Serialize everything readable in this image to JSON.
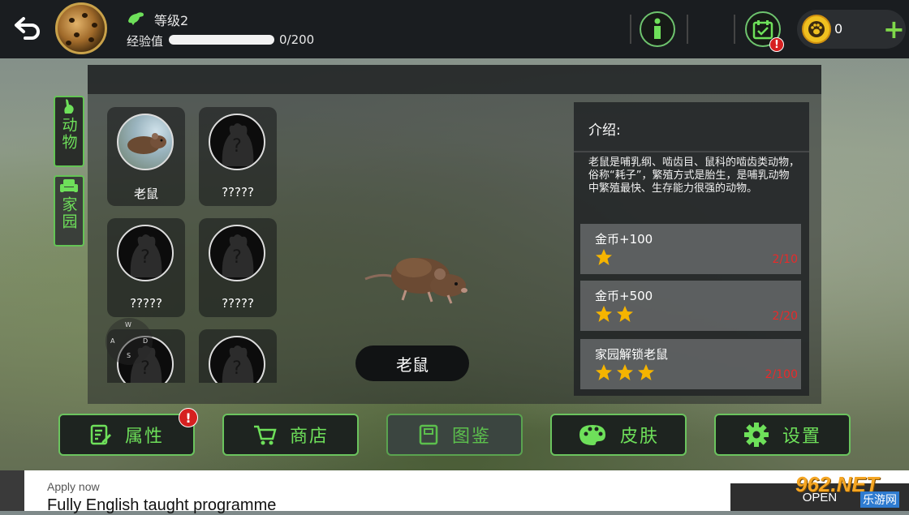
{
  "topbar": {
    "level_label": "等级2",
    "xp_label": "经验值",
    "xp_value": "0/200",
    "xp_progress": 0.0,
    "currency_amount": "0"
  },
  "side_tabs": [
    {
      "label": "动物",
      "icon": "rabbit-icon"
    },
    {
      "label": "家园",
      "icon": "sofa-icon"
    }
  ],
  "animals": [
    {
      "name": "老鼠",
      "unlocked": true
    },
    {
      "name": "?????",
      "unlocked": false
    },
    {
      "name": "?????",
      "unlocked": false
    },
    {
      "name": "?????",
      "unlocked": false
    },
    {
      "name": "",
      "unlocked": false
    },
    {
      "name": "",
      "unlocked": false
    }
  ],
  "joystick": {
    "w": "W",
    "a": "A",
    "s": "S",
    "d": "D"
  },
  "selected_animal": "老鼠",
  "info": {
    "title": "介绍:",
    "description": "老鼠是哺乳纲、啮齿目、鼠科的啮齿类动物，俗称“耗子”，繁殖方式是胎生，是哺乳动物中繁殖最快、生存能力很强的动物。",
    "rewards": [
      {
        "title": "金币+100",
        "stars": 1,
        "progress": "2/10"
      },
      {
        "title": "金币+500",
        "stars": 2,
        "progress": "2/20"
      },
      {
        "title": "家园解锁老鼠",
        "stars": 3,
        "progress": "2/100"
      }
    ]
  },
  "bottom_buttons": [
    {
      "label": "属性",
      "icon": "edit-list-icon",
      "alert": "!"
    },
    {
      "label": "商店",
      "icon": "cart-icon"
    },
    {
      "label": "图鉴",
      "icon": "book-icon",
      "active": true
    },
    {
      "label": "皮肤",
      "icon": "palette-icon"
    },
    {
      "label": "设置",
      "icon": "gear-icon"
    }
  ],
  "alerts": {
    "calendar": "!"
  },
  "ad": {
    "apply": "Apply now",
    "headline": "Fully English taught programme",
    "open": "OPEN"
  },
  "watermark": {
    "logo": "962.NET",
    "sub": "乐游网"
  },
  "colors": {
    "accent_green": "#6ee05a",
    "alert_red": "#d62020",
    "progress_red": "#e82a2a",
    "star_yellow": "#f5b400"
  }
}
